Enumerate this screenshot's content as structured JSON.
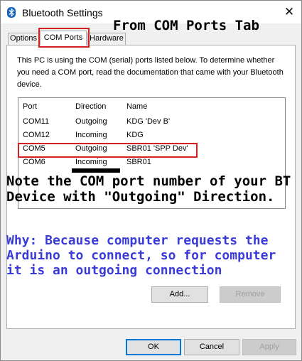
{
  "window": {
    "title": "Bluetooth Settings",
    "close_glyph": "✕",
    "icon": "bluetooth-icon"
  },
  "annotation": {
    "title": "From COM Ports Tab",
    "note": "Note the COM port number of your BT Device with \"Outgoing\" Direction.",
    "why": "Why: Because computer requests the Arduino to connect, so for computer it is an outgoing connection",
    "highlight_color": "#d32020",
    "why_color": "#3b3bd6"
  },
  "tabs": [
    {
      "label": "Options"
    },
    {
      "label": "COM Ports"
    },
    {
      "label": "Hardware"
    }
  ],
  "panel": {
    "description": "This PC is using the COM (serial) ports listed below. To determine whether you need a COM port, read the documentation that came with your Bluetooth device."
  },
  "ports_table": {
    "columns": [
      "Port",
      "Direction",
      "Name"
    ],
    "rows": [
      {
        "port": "COM11",
        "direction": "Outgoing",
        "name": "KDG 'Dev B'"
      },
      {
        "port": "COM12",
        "direction": "Incoming",
        "name": "KDG"
      },
      {
        "port": "COM5",
        "direction": "Outgoing",
        "name": "SBR01 'SPP Dev'"
      },
      {
        "port": "COM6",
        "direction": "Incoming",
        "name": "SBR01"
      }
    ]
  },
  "panel_buttons": {
    "add": "Add...",
    "remove": "Remove"
  },
  "dialog_buttons": {
    "ok": "OK",
    "cancel": "Cancel",
    "apply": "Apply"
  }
}
